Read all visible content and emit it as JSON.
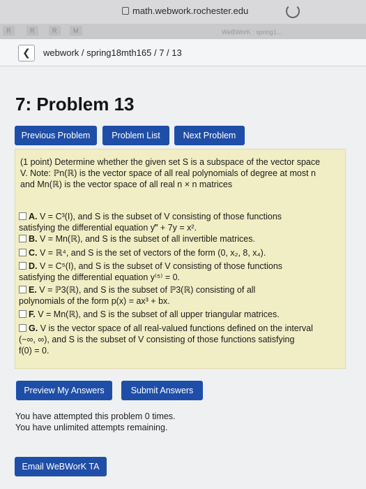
{
  "browser": {
    "url": "math.webwork.rochester.edu",
    "tabs": [
      "R",
      "R",
      "R",
      "M"
    ],
    "tab_title": "WeBWorK : spring1..."
  },
  "breadcrumb": "webwork / spring18mth165 / 7 / 13",
  "page_title": "7: Problem 13",
  "nav": {
    "previous": "Previous Problem",
    "list": "Problem List",
    "next": "Next Problem"
  },
  "problem": {
    "intro_line1": "(1 point) Determine whether the given set S is a subspace of the vector space",
    "intro_line2": "V. Note: ℙn(ℝ) is the vector space of all real polynomials of degree at most n",
    "intro_line3": "and Mn(ℝ) is the vector space of all real n × n matrices",
    "options": [
      {
        "letter": "A.",
        "line1": "V = C³(I), and S is the subset of V consisting of those functions",
        "line2": "satisfying the differential equation y‴ + 7y = x²."
      },
      {
        "letter": "B.",
        "line1": "V = Mn(ℝ), and S is the subset of all invertible matrices.",
        "line2": ""
      },
      {
        "letter": "C.",
        "line1": "V = ℝ⁴, and S is the set of vectors of the form (0, x₂, 8, x₄).",
        "line2": ""
      },
      {
        "letter": "D.",
        "line1": "V = C⁵(I), and S is the subset of V consisting of those functions",
        "line2": "satisfying the differential equation y⁽⁵⁾ = 0."
      },
      {
        "letter": "E.",
        "line1": "V = ℙ3(ℝ), and S is the subset of ℙ3(ℝ) consisting of all",
        "line2": "polynomials of the form p(x) = ax³ + bx."
      },
      {
        "letter": "F.",
        "line1": "V = Mn(ℝ), and S is the subset of all upper triangular matrices.",
        "line2": ""
      },
      {
        "letter": "G.",
        "line1": "V is the vector space of all real-valued functions defined on the interval",
        "line2": "(−∞, ∞), and S is the subset of V consisting of those functions satisfying",
        "line3": "f(0) = 0."
      }
    ]
  },
  "actions": {
    "preview": "Preview My Answers",
    "submit": "Submit Answers"
  },
  "status": {
    "line1": "You have attempted this problem 0 times.",
    "line2": "You have unlimited attempts remaining."
  },
  "email_button": "Email WeBWorK TA"
}
